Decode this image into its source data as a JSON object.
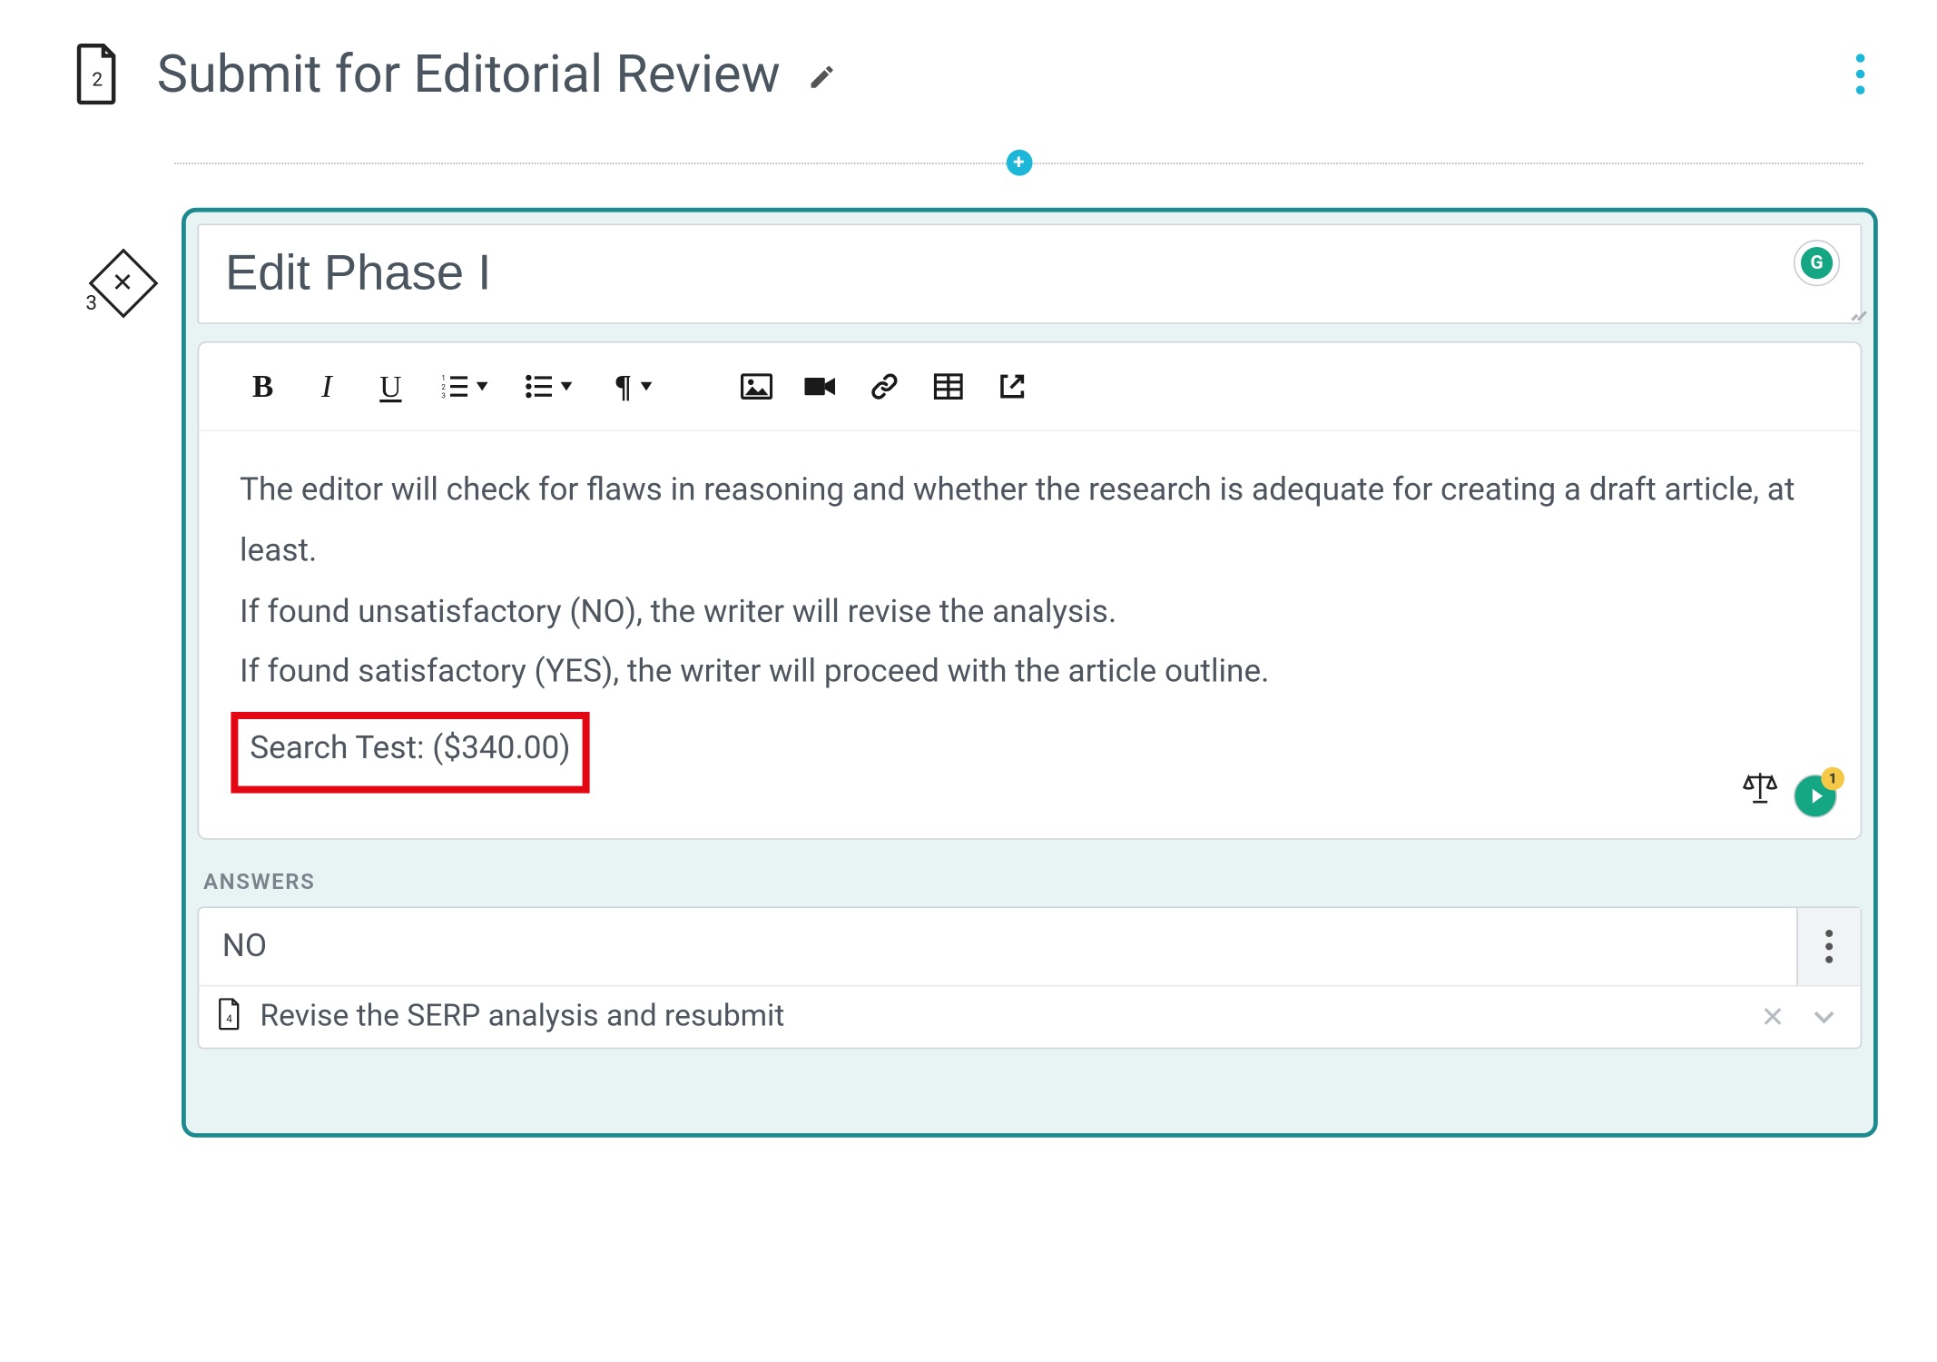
{
  "header": {
    "step_number": "2",
    "title": "Submit for Editorial Review"
  },
  "card": {
    "gutter_number": "3",
    "title": "Edit Phase I",
    "body": {
      "line1": "The editor will check for flaws in reasoning and whether the research is adequate for creating a draft article, at least.",
      "line2": "If found unsatisfactory (NO), the writer will revise the analysis.",
      "line3": "If found satisfactory (YES), the writer will proceed with the article outline.",
      "highlighted": "Search Test: ($340.00)"
    },
    "grammarly_badge": "1",
    "answers_label": "ANSWERS",
    "answers": [
      {
        "label": "NO",
        "sub": "Revise the SERP analysis and resubmit"
      }
    ]
  }
}
